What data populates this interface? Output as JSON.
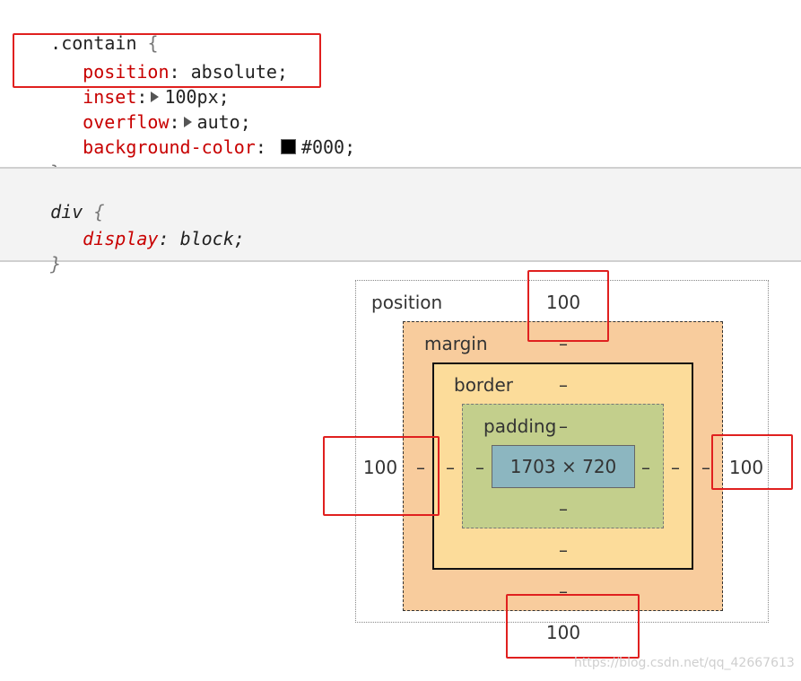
{
  "rule1": {
    "selector": ".contain",
    "open_brace": "{",
    "close_brace": "}",
    "decls": [
      {
        "prop": "position",
        "value": "absolute;"
      },
      {
        "prop": "inset",
        "value": "100px;"
      },
      {
        "prop": "overflow",
        "value": "auto;"
      },
      {
        "prop": "background-color",
        "value": "#000;"
      }
    ],
    "swatch_color": "#000000"
  },
  "rule2": {
    "selector": "div",
    "open_brace": "{",
    "close_brace": "}",
    "decl": {
      "prop": "display",
      "value": "block;"
    }
  },
  "box_model": {
    "position_label": "position",
    "position_top": "100",
    "position_left": "100",
    "position_right": "100",
    "position_bottom": "100",
    "margin_label": "margin",
    "margin_top": "–",
    "margin_left": "–",
    "margin_right": "–",
    "margin_bottom": "–",
    "border_label": "border",
    "border_top": "–",
    "border_left": "–",
    "border_right": "–",
    "border_bottom": "–",
    "padding_label": "padding",
    "padding_top": "–",
    "padding_left": "–",
    "padding_right": "–",
    "padding_bottom": "–",
    "content_size": "1703 × 720"
  },
  "watermark": "https://blog.csdn.net/qq_42667613",
  "colors": {
    "highlight": "#e0201f",
    "property": "#c80000",
    "margin": "#f8cc9d",
    "border": "#fcdc9a",
    "padding": "#c3cf8c",
    "content": "#8cb6c0"
  }
}
